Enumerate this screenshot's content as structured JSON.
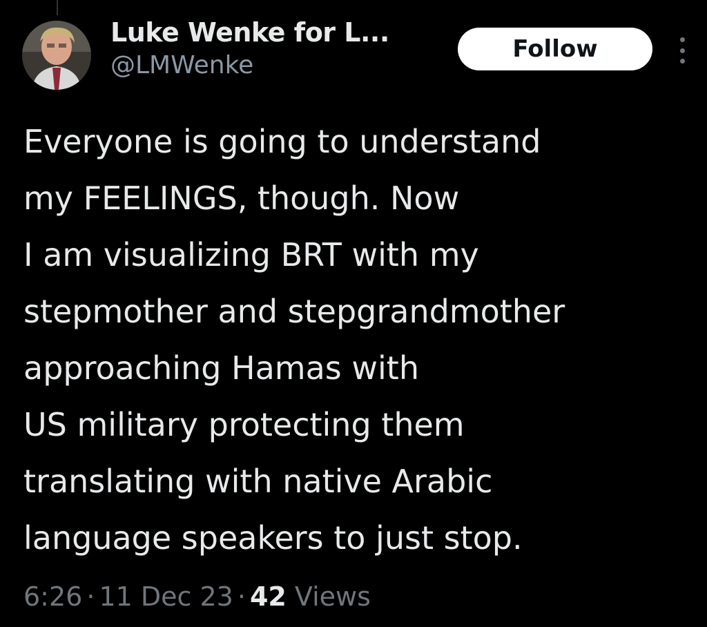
{
  "tweet": {
    "author": {
      "display_name": "Luke Wenke for L...",
      "handle": "@LMWenke"
    },
    "follow_label": "Follow",
    "more_icon": "more-vertical-icon",
    "text_lines": [
      "Everyone is going to understand",
      "my FEELINGS, though.  Now",
      "I am visualizing BRT with my",
      "stepmother and stepgrandmother",
      "approaching Hamas with",
      "US military protecting them",
      "translating with native Arabic",
      "language speakers to just stop."
    ],
    "meta": {
      "time": "6:26",
      "date": "11 Dec 23",
      "separator": "·",
      "views_count": "42",
      "views_label": "Views"
    }
  },
  "colors": {
    "background": "#000000",
    "primary_text": "#e7e9ea",
    "secondary_text": "#71767b",
    "follow_button_bg": "#ffffff",
    "follow_button_text": "#0f1419"
  }
}
